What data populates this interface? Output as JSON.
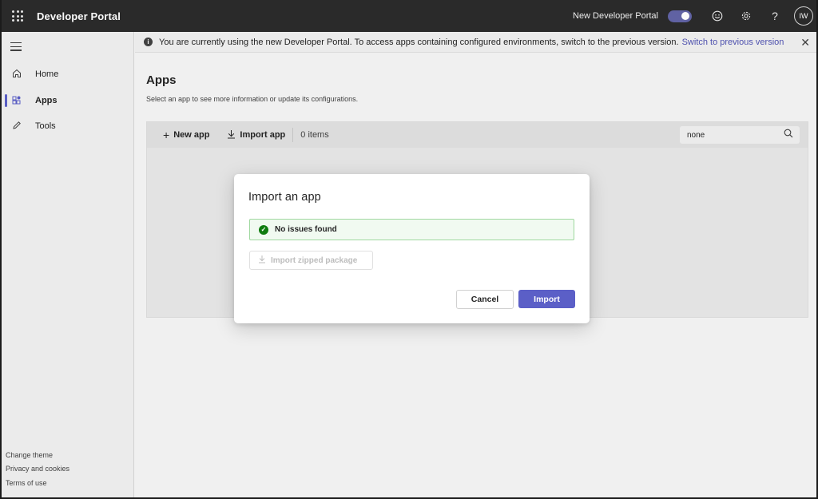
{
  "topbar": {
    "app_title": "Developer Portal",
    "new_portal_label": "New Developer Portal",
    "toggle_on": true,
    "avatar_initials": "IW"
  },
  "sidebar": {
    "items": [
      {
        "label": "Home",
        "icon": "home-icon",
        "active": false
      },
      {
        "label": "Apps",
        "icon": "apps-icon",
        "active": true
      },
      {
        "label": "Tools",
        "icon": "pencil-icon",
        "active": false
      }
    ],
    "footer": [
      "Change theme",
      "Privacy and cookies",
      "Terms of use"
    ]
  },
  "banner": {
    "message": "You are currently using the new Developer Portal. To access apps containing configured environments, switch to the previous version.",
    "link": "Switch to previous version"
  },
  "main": {
    "title": "Apps",
    "subtitle": "Select an app to see more information or update its configurations.",
    "toolbar": {
      "new_app": "New app",
      "import_app": "Import app",
      "items_count": "0 items",
      "search_value": "none"
    }
  },
  "dialog": {
    "title": "Import an app",
    "status": "No issues found",
    "import_zip": "Import zipped package",
    "cancel": "Cancel",
    "import": "Import"
  },
  "colors": {
    "accent": "#5b5fc7",
    "topbar": "#2b2b2b",
    "success": "#107c10",
    "success_bg": "#f1faf1"
  }
}
